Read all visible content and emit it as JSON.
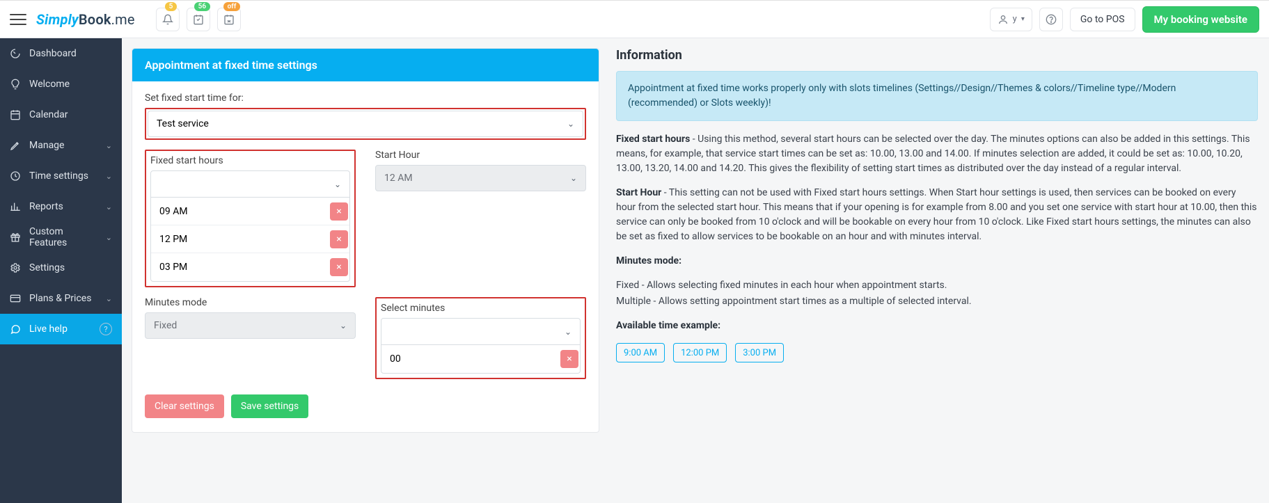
{
  "header": {
    "logo_part1": "Simply",
    "logo_part2": "Book",
    "logo_part3": ".me",
    "badge_notifications": "5",
    "badge_tasks": "56",
    "badge_status": "off",
    "user_label": "y",
    "go_to_pos": "Go to POS",
    "booking_website": "My booking website"
  },
  "sidebar": {
    "items": [
      {
        "label": "Dashboard",
        "icon": "gauge-icon",
        "expandable": false
      },
      {
        "label": "Welcome",
        "icon": "bulb-icon",
        "expandable": false
      },
      {
        "label": "Calendar",
        "icon": "calendar-icon",
        "expandable": false
      },
      {
        "label": "Manage",
        "icon": "pencil-icon",
        "expandable": true
      },
      {
        "label": "Time settings",
        "icon": "clock-icon",
        "expandable": true
      },
      {
        "label": "Reports",
        "icon": "bar-icon",
        "expandable": true
      },
      {
        "label": "Custom Features",
        "icon": "gift-icon",
        "expandable": true
      },
      {
        "label": "Settings",
        "icon": "gear-icon",
        "expandable": false
      },
      {
        "label": "Plans & Prices",
        "icon": "card-icon",
        "expandable": true
      }
    ],
    "live_help": "Live help"
  },
  "panel": {
    "title": "Appointment at fixed time settings",
    "set_for_label": "Set fixed start time for:",
    "service_selected": "Test service",
    "fixed_hours_label": "Fixed start hours",
    "fixed_hours": [
      "09 AM",
      "12 PM",
      "03 PM"
    ],
    "start_hour_label": "Start Hour",
    "start_hour_value": "12 AM",
    "minutes_mode_label": "Minutes mode",
    "minutes_mode_value": "Fixed",
    "select_minutes_label": "Select minutes",
    "select_minutes": [
      "00"
    ],
    "clear_btn": "Clear settings",
    "save_btn": "Save settings"
  },
  "info": {
    "title": "Information",
    "alert": "Appointment at fixed time works properly only with slots timelines (Settings//Design//Themes & colors//Timeline type//Modern (recommended) or Slots weekly)!",
    "p1_b": "Fixed start hours",
    "p1": " - Using this method, several start hours can be selected over the day. The minutes options can also be added in this settings. This means, for example, that service start times can be set as: 10.00, 13.00 and 14.00. If minutes selection are added, it could be set as: 10.00, 10.20, 13.00, 13.20, 14.00 and 14.20. This gives the flexibility of setting start times as distributed over the day instead of a regular interval.",
    "p2_b": "Start Hour",
    "p2": " - This setting can not be used with Fixed start hours settings. When Start hour settings is used, then services can be booked on every hour from the selected start hour. This means that if your opening is for example from 8.00 and you set one service with start hour at 10.00, then this service can only be booked from 10 o'clock and will be bookable on every hour from 10 o'clock. Like Fixed start hours settings, the minutes can also be set as fixed to allow services to be bookable on an hour and with minutes interval.",
    "p3_b": "Minutes mode:",
    "p4a": "Fixed - Allows selecting fixed minutes in each hour when appointment starts.",
    "p4b": "Multiple - Allows setting appointment start times as a multiple of selected interval.",
    "p5_b": "Available time example:",
    "examples": [
      "9:00 AM",
      "12:00 PM",
      "3:00 PM"
    ]
  }
}
